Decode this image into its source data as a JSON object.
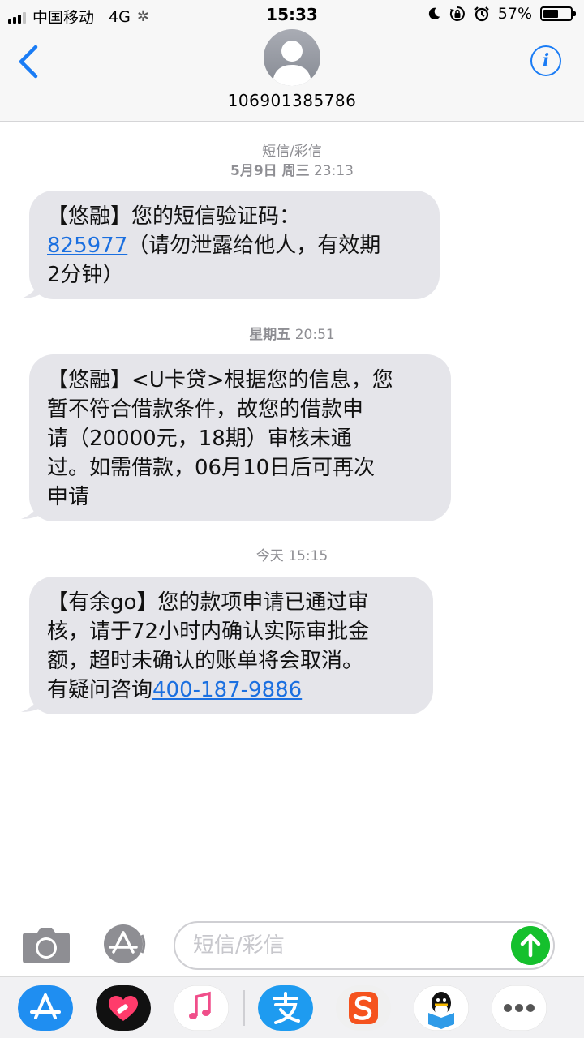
{
  "status_bar": {
    "carrier": "中国移动",
    "network": "4G",
    "time": "15:33",
    "battery": "57%",
    "battery_level": 0.57
  },
  "header": {
    "contact": "106901385786"
  },
  "messages": [
    {
      "timestamp": {
        "type_label": "短信/彩信",
        "date_bold": "5月9日 周三",
        "time": "23:13"
      },
      "lines": [
        [
          {
            "text": "【悠融】您的短信验证码："
          }
        ],
        [
          {
            "text": "825977",
            "link": true
          },
          {
            "text": "（请勿泄露给他人，有效期"
          }
        ],
        [
          {
            "text": "2分钟）"
          }
        ]
      ]
    },
    {
      "timestamp": {
        "date_bold": "星期五",
        "time": "20:51"
      },
      "lines": [
        [
          {
            "text": "【悠融】<U卡贷>根据您的信息，您"
          }
        ],
        [
          {
            "text": "暂不符合借款条件，故您的借款申"
          }
        ],
        [
          {
            "text": "请（20000元，18期）审核未通"
          }
        ],
        [
          {
            "text": "过。如需借款，06月10日后可再次"
          }
        ],
        [
          {
            "text": "申请"
          }
        ]
      ]
    },
    {
      "timestamp": {
        "date_plain": "今天",
        "time": "15:15"
      },
      "lines": [
        [
          {
            "text": "【有余go】您的款项申请已通过审"
          }
        ],
        [
          {
            "text": "核，请于72小时内确认实际审批金"
          }
        ],
        [
          {
            "text": "额，超时未确认的账单将会取消。"
          }
        ],
        [
          {
            "text": "有疑问咨询"
          },
          {
            "text": "400-187-9886",
            "link": true
          }
        ]
      ]
    }
  ],
  "composer": {
    "placeholder": "短信/彩信"
  },
  "colors": {
    "link": "#1a6fe0",
    "bubble": "#e5e5ea",
    "send": "#15c02d",
    "accent": "#1a7cf5"
  },
  "app_strip": [
    "app-store-icon",
    "heart-app-icon",
    "music-icon",
    "alipay-icon",
    "sogou-icon",
    "qq-reader-icon",
    "more-icon"
  ]
}
